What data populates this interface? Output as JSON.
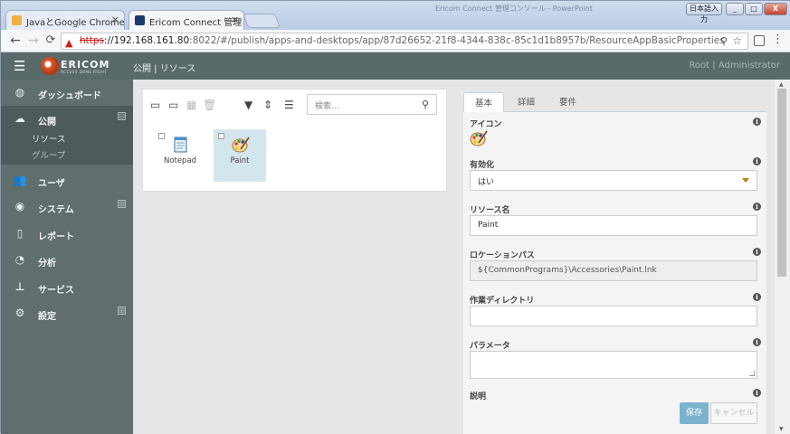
{
  "browser": {
    "tabs": [
      {
        "title": "JavaとGoogle Chrome"
      },
      {
        "title": "Ericom Connect 管理コ"
      }
    ],
    "tab_close": "×",
    "window_caption": "Ericom Connect 管理コンソール - PowerPoint",
    "window_controls": {
      "ime": "日本語入力",
      "minimize": "_",
      "maximize": "□",
      "close": "X"
    },
    "address": {
      "scheme": "https",
      "host": "://192.168.161.80",
      "path": ":8022/#/publish/apps-and-desktops/app/87d26652-21f8-4344-838c-85c1d1b8957b/ResourceAppBasicProperties"
    }
  },
  "header": {
    "breadcrumb": "公開 | リソース",
    "user": "Root | Administrator",
    "logo_name": "ERICOM",
    "logo_tagline": "ACCESS DONE RIGHT"
  },
  "sidebar": {
    "items": [
      {
        "label": "ダッシュボード",
        "icon": "dashboard-icon"
      },
      {
        "label": "公開",
        "icon": "cloud-upload-icon",
        "expander": "⊟"
      },
      {
        "label": "ユーザ",
        "icon": "users-icon"
      },
      {
        "label": "システム",
        "icon": "globe-icon",
        "expander": "⊞"
      },
      {
        "label": "レポート",
        "icon": "document-icon"
      },
      {
        "label": "分析",
        "icon": "pie-chart-icon"
      },
      {
        "label": "サービス",
        "icon": "sitemap-icon"
      },
      {
        "label": "設定",
        "icon": "gears-icon",
        "expander": "⊞"
      }
    ],
    "subitems": [
      "リソース",
      "グループ"
    ]
  },
  "resources": {
    "search_placeholder": "検索...",
    "apps": [
      {
        "name": "Notepad",
        "selected": false
      },
      {
        "name": "Paint",
        "selected": true
      }
    ]
  },
  "properties": {
    "tabs": [
      "基本",
      "詳細",
      "要件"
    ],
    "active_tab": "基本",
    "fields": {
      "icon_label": "アイコン",
      "enabled_label": "有効化",
      "enabled_value": "はい",
      "name_label": "リソース名",
      "name_value": "Paint",
      "path_label": "ロケーションパス",
      "path_value": "${CommonPrograms}\\Accessories\\Paint.lnk",
      "workdir_label": "作業ディレクトリ",
      "workdir_value": "",
      "params_label": "パラメータ",
      "params_value": "",
      "desc_label": "説明"
    },
    "save_label": "保存",
    "cancel_label": "キャンセル"
  },
  "colors": {
    "appbar": "#5a6a6a",
    "sidebar": "#606e6e",
    "save_button": "#7bb3cf",
    "selected_tile": "#d5e5ee"
  }
}
